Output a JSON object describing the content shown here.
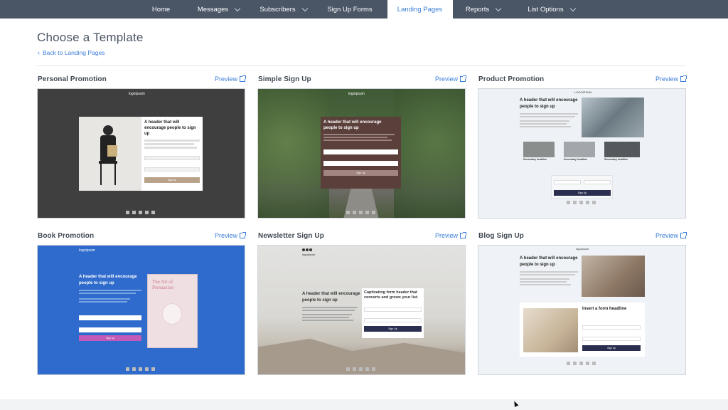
{
  "nav": {
    "items": [
      {
        "label": "Home",
        "dropdown": false,
        "active": false
      },
      {
        "label": "Messages",
        "dropdown": true,
        "active": false
      },
      {
        "label": "Subscribers",
        "dropdown": true,
        "active": false
      },
      {
        "label": "Sign Up Forms",
        "dropdown": false,
        "active": false
      },
      {
        "label": "Landing Pages",
        "dropdown": false,
        "active": true
      },
      {
        "label": "Reports",
        "dropdown": true,
        "active": false
      },
      {
        "label": "List Options",
        "dropdown": true,
        "active": false
      }
    ]
  },
  "page": {
    "title": "Choose a Template",
    "back_label": "Back to Landing Pages",
    "preview_label": "Preview"
  },
  "templates": [
    {
      "name": "Personal Promotion",
      "headline": "A header that will encourage people to sign up",
      "button": "Sign Up",
      "logo": "logoipsum"
    },
    {
      "name": "Simple Sign Up",
      "headline": "A header that will encourage people to sign up",
      "button": "Sign Up",
      "logo": "logoipsum"
    },
    {
      "name": "Product Promotion",
      "headline": "A header that will encourage people to sign up",
      "button": "Sign Up",
      "logo": "LOGOIPSUM",
      "sub": "Secondary headline"
    },
    {
      "name": "Book Promotion",
      "headline": "A header that will encourage people to sign up",
      "button": "Sign up",
      "logo": "logoipsum",
      "book_title": "The Art of Persuasion"
    },
    {
      "name": "Newsletter Sign Up",
      "headline": "A header that will encourage people to sign up",
      "button": "Sign Up",
      "logo": "logoipsum",
      "form_header": "Captivating form header that converts and grows your list."
    },
    {
      "name": "Blog Sign Up",
      "headline": "A header that will encourage people to sign up",
      "button": "Sign up",
      "logo": "logoipsum",
      "form_header": "Insert a form headline"
    }
  ],
  "colors": {
    "nav_bg": "#4a5566",
    "accent": "#3b7dd8",
    "book_blue": "#2f6bcc"
  }
}
